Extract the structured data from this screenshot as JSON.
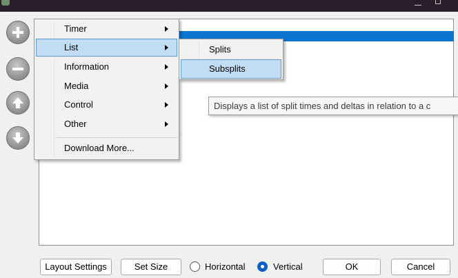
{
  "context_menu": {
    "items": [
      {
        "label": "Timer"
      },
      {
        "label": "List"
      },
      {
        "label": "Information"
      },
      {
        "label": "Media"
      },
      {
        "label": "Control"
      },
      {
        "label": "Other"
      },
      {
        "label": "Download More..."
      }
    ],
    "highlighted": "List"
  },
  "submenu": {
    "items": [
      {
        "label": "Splits"
      },
      {
        "label": "Subsplits"
      }
    ],
    "highlighted": "Subsplits"
  },
  "tooltip": {
    "text": "Displays a list of split times and deltas in relation to a c"
  },
  "side_buttons": [
    "add-icon",
    "remove-icon",
    "move-up-icon",
    "move-down-icon"
  ],
  "bottom_bar": {
    "layout_settings_label": "Layout Settings",
    "set_size_label": "Set Size",
    "horizontal_label": "Horizontal",
    "vertical_label": "Vertical",
    "orientation_selected": "Vertical",
    "ok_label": "OK",
    "cancel_label": "Cancel"
  },
  "colors": {
    "selection": "#0a74d1",
    "menu_highlight": "#c2dcf3",
    "titlebar": "#2c1d2b"
  }
}
